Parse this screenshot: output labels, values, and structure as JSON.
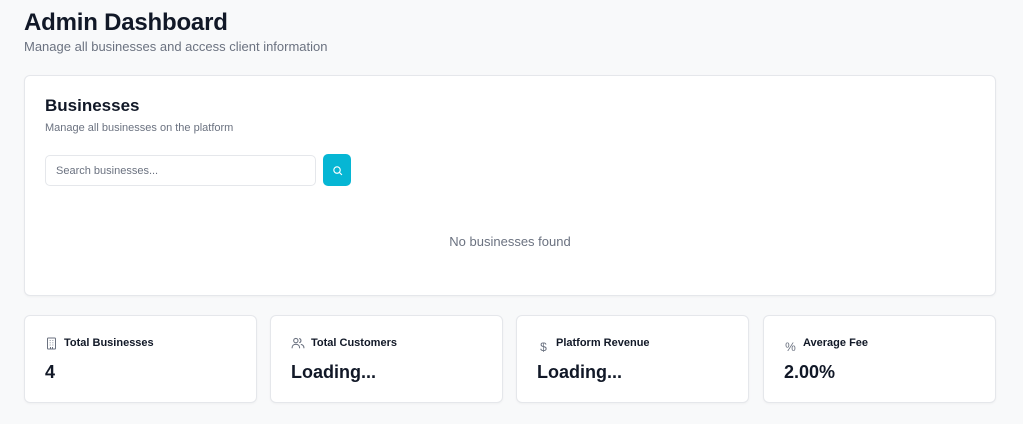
{
  "header": {
    "title": "Admin Dashboard",
    "subtitle": "Manage all businesses and access client information"
  },
  "businesses": {
    "title": "Businesses",
    "subtitle": "Manage all businesses on the platform",
    "search": {
      "placeholder": "Search businesses...",
      "value": ""
    },
    "empty_text": "No businesses found"
  },
  "stats": [
    {
      "label": "Total Businesses",
      "value": "4",
      "icon": "building-icon"
    },
    {
      "label": "Total Customers",
      "value": "Loading...",
      "icon": "users-icon"
    },
    {
      "label": "Platform Revenue",
      "value": "Loading...",
      "icon": "dollar-icon",
      "glyph": "$"
    },
    {
      "label": "Average Fee",
      "value": "2.00%",
      "icon": "percent-icon",
      "glyph": "%"
    }
  ],
  "colors": {
    "accent": "#06b6d4",
    "background": "#f8f9fa",
    "text": "#111827",
    "muted": "#6b7280",
    "border": "#e5e7eb"
  }
}
